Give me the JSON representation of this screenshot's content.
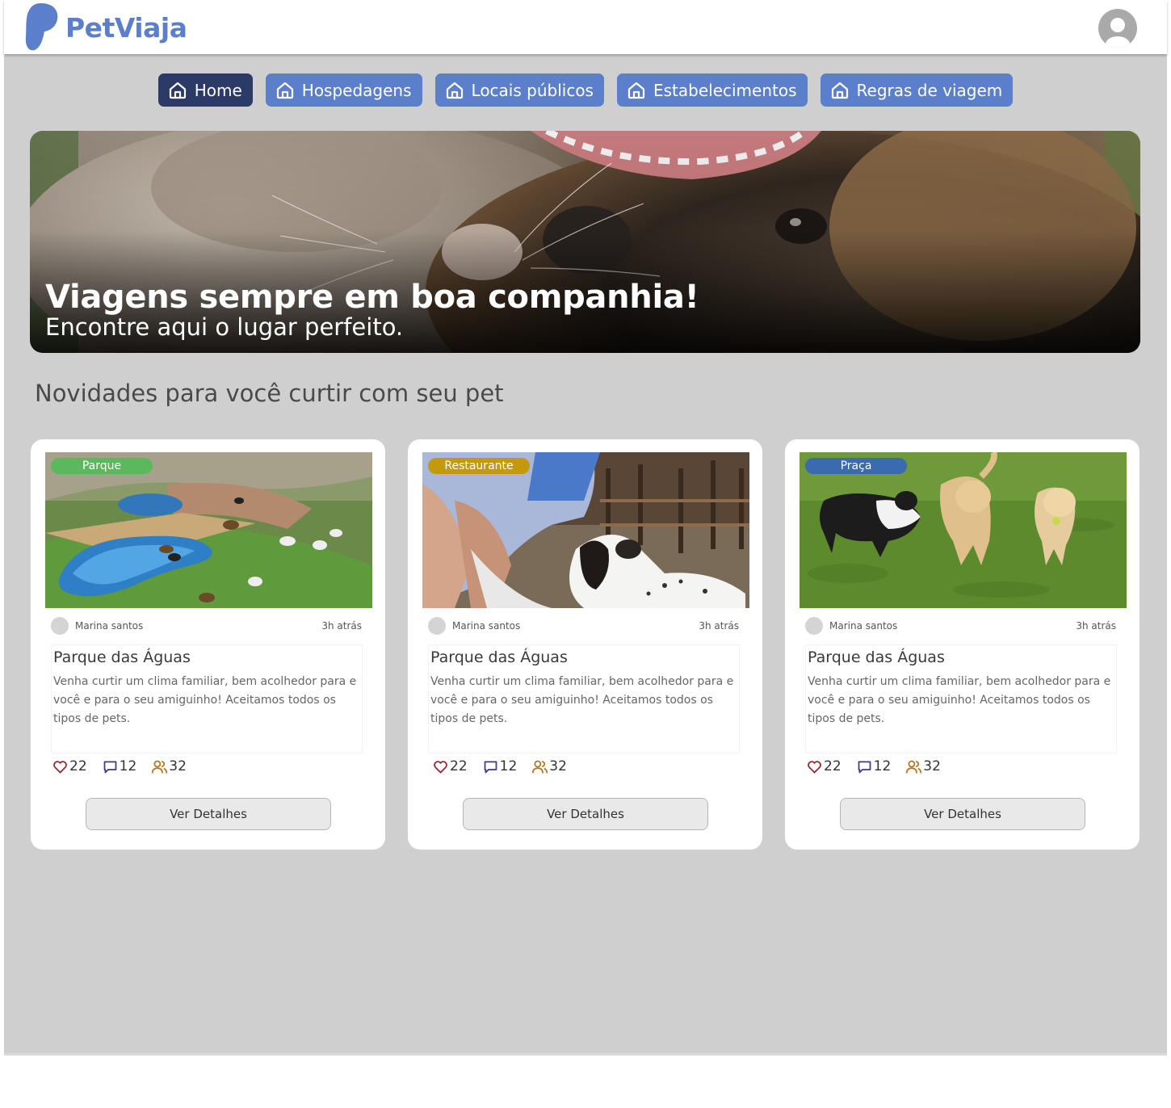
{
  "brand": {
    "name": "PetViaja",
    "color": "#5b7fcb"
  },
  "header": {
    "profile_icon": "user-avatar-icon"
  },
  "nav": {
    "items": [
      {
        "label": "Home",
        "icon": "home-icon",
        "active": true
      },
      {
        "label": "Hospedagens",
        "icon": "home-icon",
        "active": false
      },
      {
        "label": "Locais públicos",
        "icon": "home-icon",
        "active": false
      },
      {
        "label": "Estabelecimentos",
        "icon": "home-icon",
        "active": false
      },
      {
        "label": "Regras de viagem",
        "icon": "home-icon",
        "active": false
      }
    ],
    "active_color": "#2b3a67",
    "color": "#5b7fcb"
  },
  "hero": {
    "title": "Viagens sempre em boa companhia!",
    "subtitle": "Encontre aqui o lugar perfeito."
  },
  "section": {
    "title": "Novidades para você curtir com seu pet"
  },
  "cards": [
    {
      "category": "Parque",
      "category_color": "#5cb85c",
      "author": "Marina santos",
      "time": "3h atrás",
      "title": "Parque das Águas",
      "description": "Venha curtir um clima familiar, bem acolhedor para e você e para o seu amiguinho! Aceitamos todos os tipos de pets.",
      "likes": "22",
      "comments": "12",
      "people": "32",
      "button": "Ver Detalhes"
    },
    {
      "category": "Restaurante",
      "category_color": "#c49a0c",
      "author": "Marina santos",
      "time": "3h atrás",
      "title": "Parque das Águas",
      "description": "Venha curtir um clima familiar, bem acolhedor para e você e para o seu amiguinho! Aceitamos todos os tipos de pets.",
      "likes": "22",
      "comments": "12",
      "people": "32",
      "button": "Ver Detalhes"
    },
    {
      "category": "Praça",
      "category_color": "#3a6ab0",
      "author": "Marina santos",
      "time": "3h atrás",
      "title": "Parque das Águas",
      "description": "Venha curtir um clima familiar, bem acolhedor para e você e para o seu amiguinho! Aceitamos todos os tipos de pets.",
      "likes": "22",
      "comments": "12",
      "people": "32",
      "button": "Ver Detalhes"
    }
  ]
}
